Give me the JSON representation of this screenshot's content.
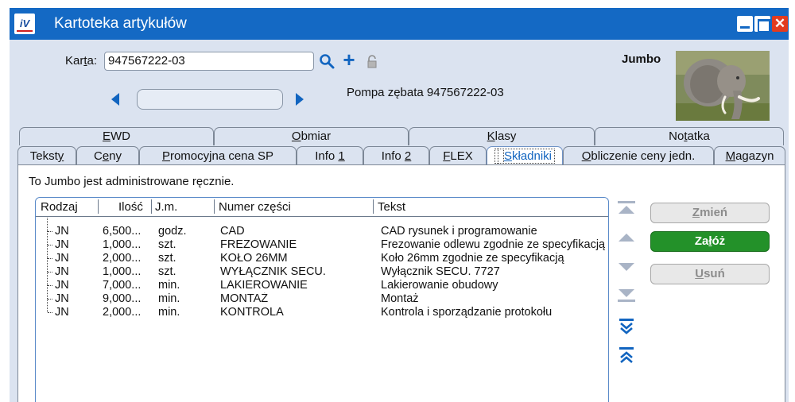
{
  "window": {
    "title": "Kartoteka artykułów",
    "controls": [
      "minimize-icon",
      "maximize-icon",
      "close-icon"
    ]
  },
  "header": {
    "karta_label_pre": "Kar",
    "karta_label_u": "t",
    "karta_label_post": "a:",
    "karta_value": "947567222-03",
    "item_description": "Pompa zębata 947567222-03",
    "photo_label": "Jumbo",
    "photo_icon": "elephant-photo"
  },
  "tabs_back": [
    {
      "label_u": "E",
      "label_rest": "WD"
    },
    {
      "label_u": "O",
      "label_rest": "bmiar"
    },
    {
      "label_u": "K",
      "label_rest": "lasy"
    },
    {
      "label_pre": "No",
      "label_u": "t",
      "label_rest": "atka"
    }
  ],
  "tabs_front": [
    {
      "label_pre": "Tekst",
      "label_u": "y",
      "label_rest": ""
    },
    {
      "label_pre": "C",
      "label_u": "e",
      "label_rest": "ny"
    },
    {
      "label_pre": "",
      "label_u": "P",
      "label_rest": "romocyjna cena SP"
    },
    {
      "label_pre": "Info ",
      "label_u": "1",
      "label_rest": ""
    },
    {
      "label_pre": "Info ",
      "label_u": "2",
      "label_rest": ""
    },
    {
      "label_pre": "",
      "label_u": "F",
      "label_rest": "LEX"
    },
    {
      "label_pre": "",
      "label_u": "S",
      "label_rest": "kładniki"
    },
    {
      "label_pre": "",
      "label_u": "O",
      "label_rest": "bliczenie ceny jedn."
    },
    {
      "label_pre": "",
      "label_u": "M",
      "label_rest": "agazyn"
    }
  ],
  "active_tab": "Składniki",
  "panel_note": "To Jumbo jest administrowane ręcznie.",
  "list": {
    "columns": [
      "Rodzaj",
      "Ilość",
      "J.m.",
      "Numer części",
      "Tekst"
    ],
    "rows": [
      [
        "JN",
        "6,500...",
        "godz.",
        "CAD",
        "CAD rysunek i programowanie"
      ],
      [
        "JN",
        "1,000...",
        "szt.",
        "FREZOWANIE",
        "Frezowanie odlewu zgodnie ze specyfikacją"
      ],
      [
        "JN",
        "2,000...",
        "szt.",
        "KOŁO 26MM",
        "Koło 26mm zgodnie ze specyfikacją"
      ],
      [
        "JN",
        "1,000...",
        "szt.",
        "WYŁĄCZNIK SECU.",
        "Wyłącznik SECU. 7727"
      ],
      [
        "JN",
        "7,000...",
        "min.",
        "LAKIEROWANIE",
        "Lakierowanie obudowy"
      ],
      [
        "JN",
        "9,000...",
        "min.",
        "MONTAŻ",
        "Montaż"
      ],
      [
        "JN",
        "2,000...",
        "min.",
        "KONTROLA",
        "Kontrola i sporządzanie protokołu"
      ]
    ]
  },
  "move_arrows": [
    "move-top-icon",
    "move-up-icon",
    "move-down-icon",
    "move-bottom-icon",
    "expand-all-icon",
    "collapse-all-icon"
  ],
  "buttons": {
    "change": {
      "label_u": "Z",
      "label_rest": "mień",
      "enabled": false
    },
    "create": {
      "label_pre": "Za",
      "label_u": "ł",
      "label_rest": "óż",
      "enabled": true
    },
    "delete": {
      "label_u": "U",
      "label_rest": "suń",
      "enabled": false
    }
  },
  "colors": {
    "titlebar": "#1469c4",
    "accent_blue": "#1265c0",
    "primary_button": "#239129",
    "close_button": "#e23b1f",
    "body_bg": "#dbe3f0"
  }
}
